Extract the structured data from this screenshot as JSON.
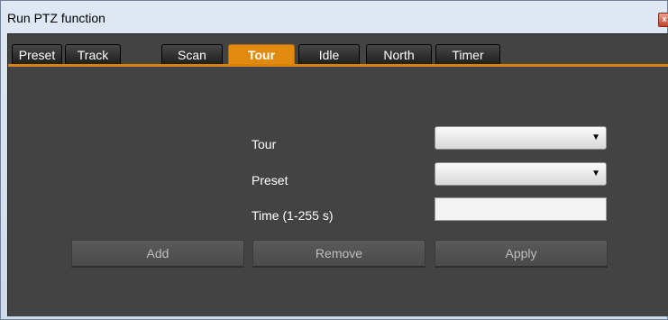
{
  "window": {
    "title": "Run PTZ function",
    "close_glyph": "x"
  },
  "tabs": [
    {
      "label": "Preset",
      "active": false
    },
    {
      "label": "Track",
      "active": false
    },
    {
      "label": "Scan",
      "active": false
    },
    {
      "label": "Tour",
      "active": true
    },
    {
      "label": "Idle",
      "active": false
    },
    {
      "label": "North",
      "active": false
    },
    {
      "label": "Timer",
      "active": false
    }
  ],
  "form": {
    "tour_label": "Tour",
    "tour_value": "",
    "preset_label": "Preset",
    "preset_value": "",
    "time_label": "Time (1-255 s)",
    "time_value": ""
  },
  "buttons": {
    "add": "Add",
    "remove": "Remove",
    "apply": "Apply"
  },
  "colors": {
    "panel_bg": "#434343",
    "accent_orange": "#e08a10",
    "button_text": "#bdbdbd"
  }
}
